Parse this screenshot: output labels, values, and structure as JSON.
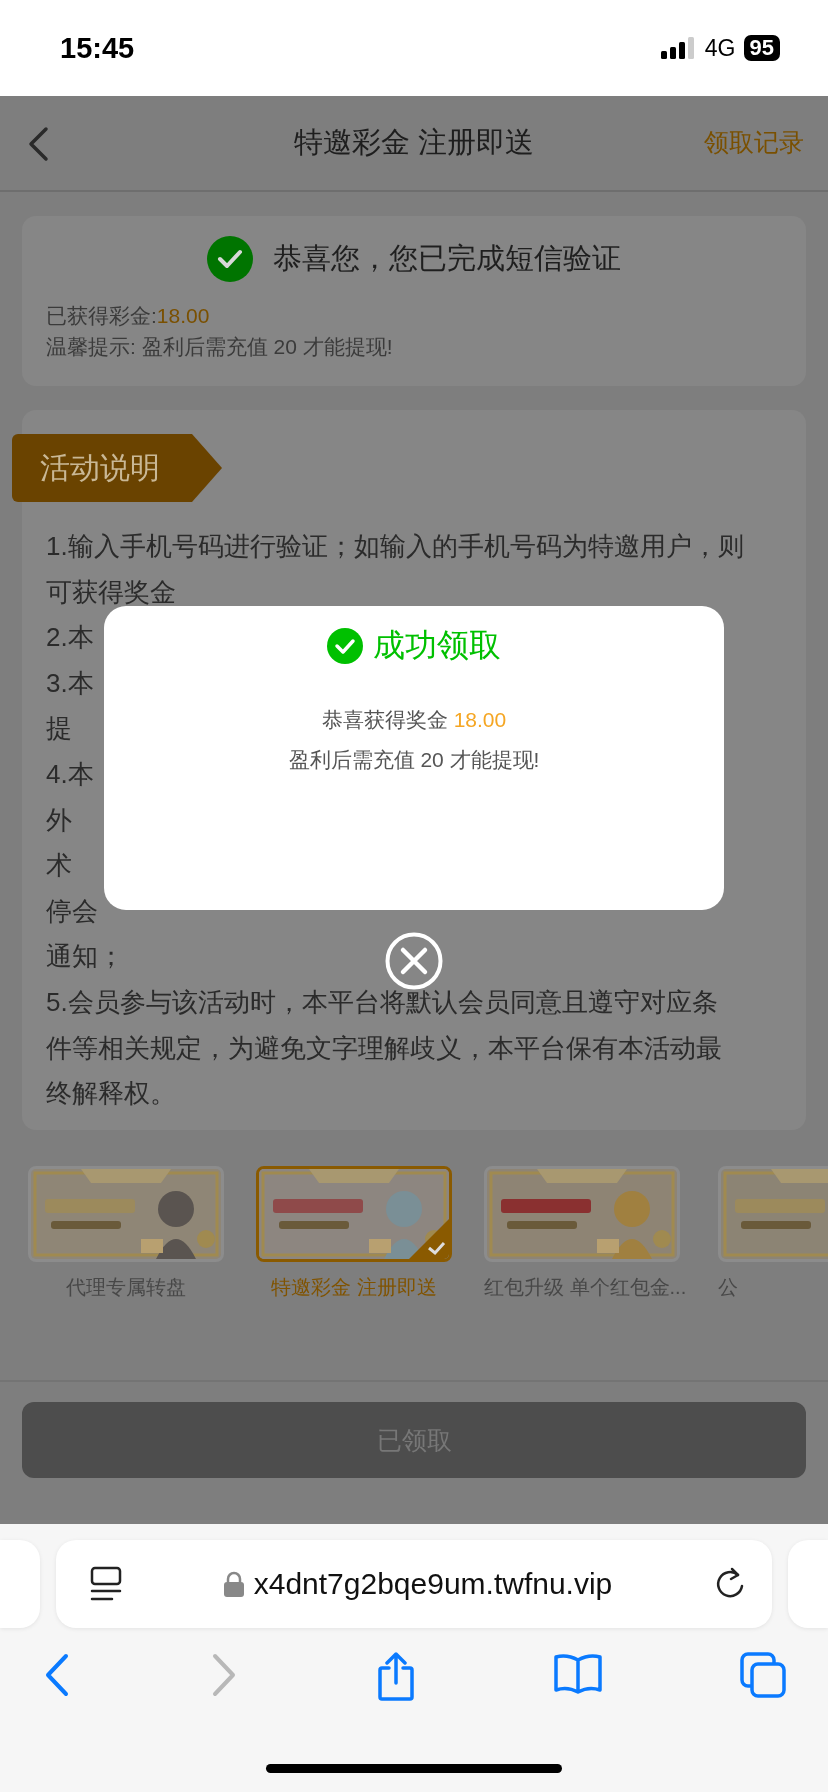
{
  "status_bar": {
    "time": "15:45",
    "network": "4G",
    "battery": "95"
  },
  "header": {
    "title": "特邀彩金 注册即送",
    "action": "领取记录"
  },
  "verify_card": {
    "message": "恭喜您，您已完成短信验证",
    "bonus_label": "已获得彩金:",
    "bonus_amount": "18.00",
    "tip": "温馨提示: 盈利后需充值 20 才能提现!"
  },
  "activity": {
    "heading": "活动说明",
    "lines": [
      "1.输入手机号码进行验证；如输入的手机号码为特邀用户，则",
      "可获得奖金",
      "2.本",
      "3.本",
      "提",
      "4.本",
      "外",
      "术",
      "停会",
      "通知；",
      "5.会员参与该活动时，本平台将默认会员同意且遵守对应条",
      "件等相关规定，为避免文字理解歧义，本平台保有本活动最",
      "终解释权。"
    ]
  },
  "promos": [
    {
      "caption": "代理专属转盘",
      "selected": false
    },
    {
      "caption": "特邀彩金 注册即送",
      "selected": true
    },
    {
      "caption": "红包升级 单个红包金...",
      "selected": false
    },
    {
      "caption": "公",
      "selected": false
    }
  ],
  "claim_button": {
    "label": "已领取",
    "disabled": true
  },
  "modal": {
    "title": "成功领取",
    "prize_label": "恭喜获得奖金",
    "prize_amount": "18.00",
    "note": "盈利后需充值 20 才能提现!"
  },
  "browser": {
    "url": "x4dnt7g2bqe9um.twfnu.vip",
    "forward_disabled": true
  }
}
